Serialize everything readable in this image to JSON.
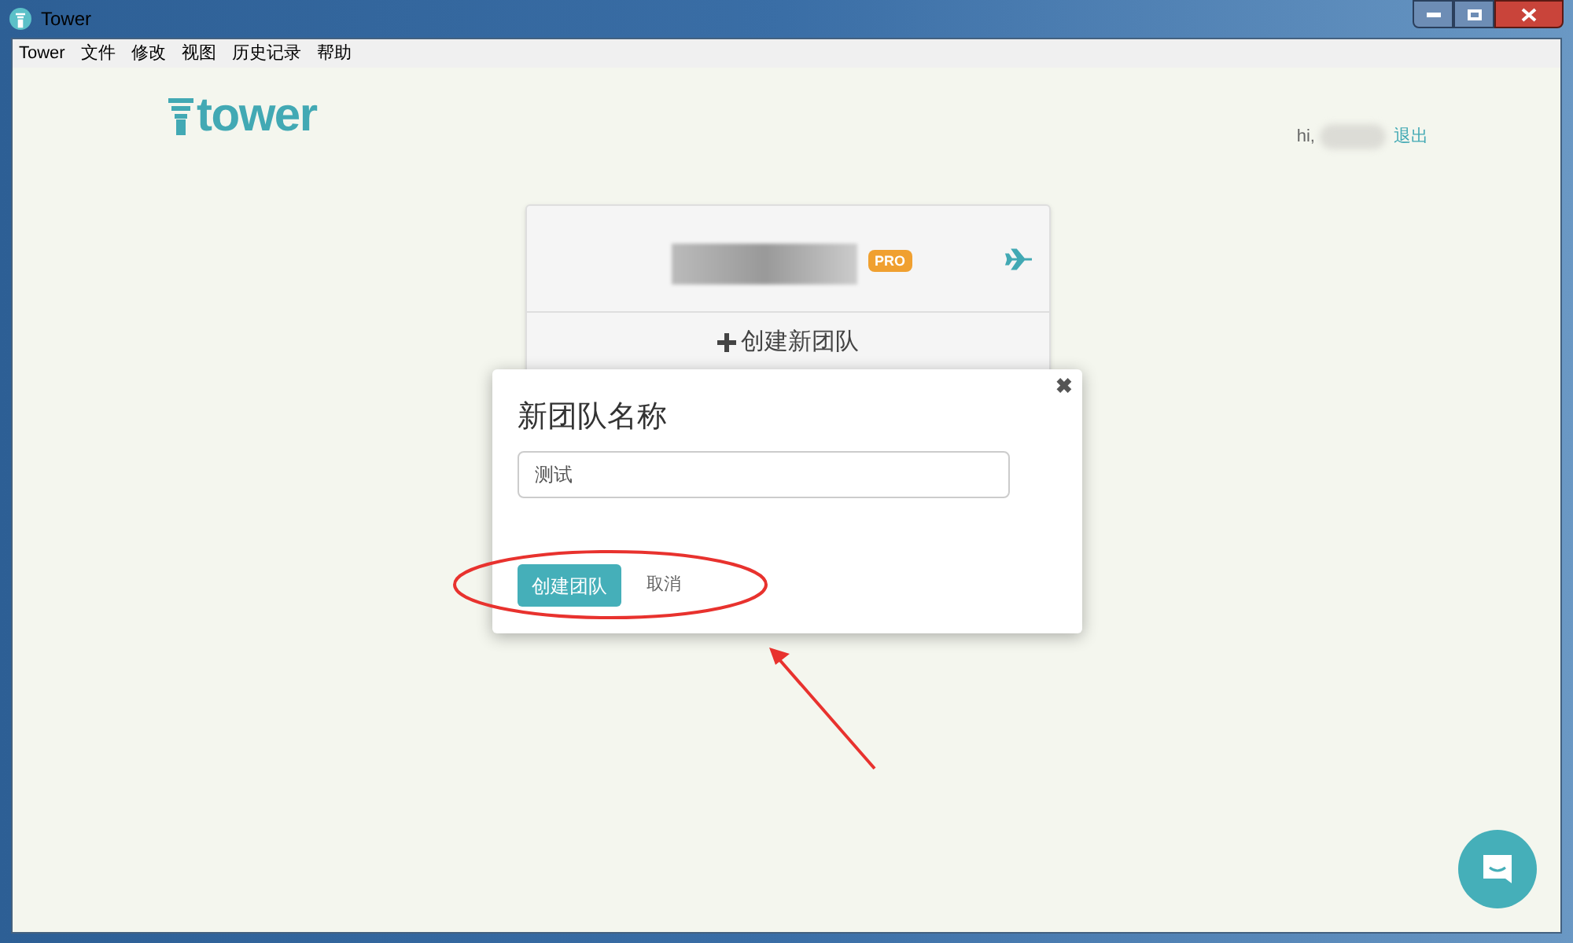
{
  "window": {
    "title": "Tower"
  },
  "menu": [
    "Tower",
    "文件",
    "修改",
    "视图",
    "历史记录",
    "帮助"
  ],
  "logo": {
    "text": "tower"
  },
  "user": {
    "greeting": "hi,",
    "logout": "退出"
  },
  "team_card": {
    "badge": "PRO",
    "create_label": "创建新团队"
  },
  "dialog": {
    "title": "新团队名称",
    "input_value": "测试",
    "primary_button": "创建团队",
    "cancel_button": "取消",
    "close": "✖"
  }
}
